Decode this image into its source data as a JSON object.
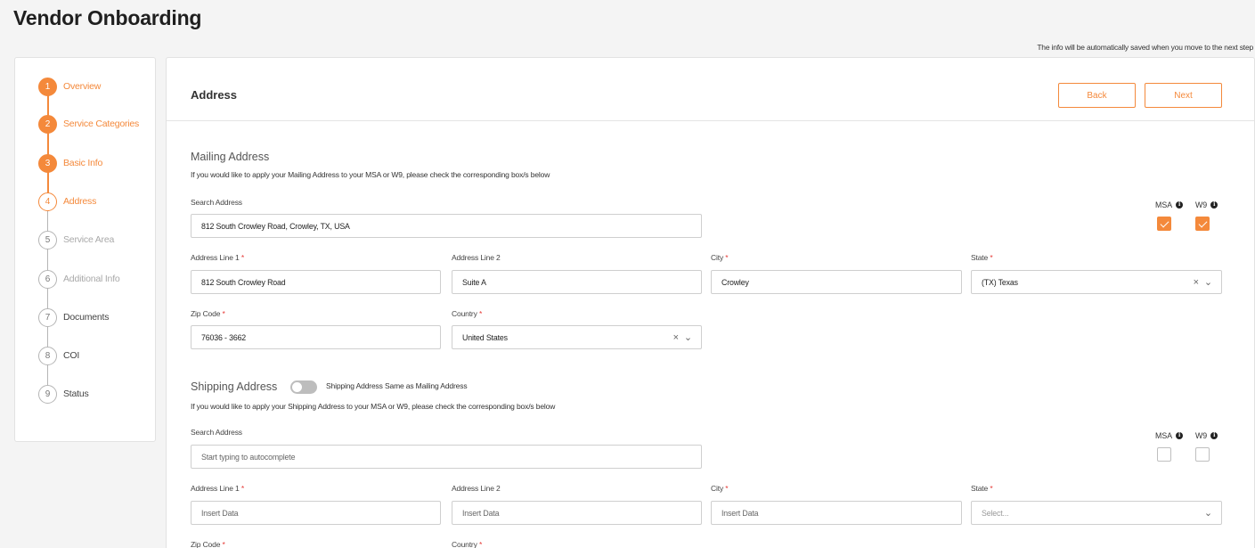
{
  "page": {
    "title": "Vendor Onboarding",
    "autosave_note": "The info will be automatically saved when you move to the next step"
  },
  "steps": [
    {
      "num": "1",
      "label": "Overview",
      "state": "done"
    },
    {
      "num": "2",
      "label": "Service Categories",
      "state": "done"
    },
    {
      "num": "3",
      "label": "Basic Info",
      "state": "done"
    },
    {
      "num": "4",
      "label": "Address",
      "state": "current"
    },
    {
      "num": "5",
      "label": "Service Area",
      "state": "pending"
    },
    {
      "num": "6",
      "label": "Additional Info",
      "state": "pending"
    },
    {
      "num": "7",
      "label": "Documents",
      "state": "pending"
    },
    {
      "num": "8",
      "label": "COI",
      "state": "pending"
    },
    {
      "num": "9",
      "label": "Status",
      "state": "pending"
    }
  ],
  "panel": {
    "title": "Address",
    "back_label": "Back",
    "next_label": "Next"
  },
  "mailing": {
    "title": "Mailing Address",
    "subtitle": "If you would like to apply your Mailing Address to your MSA or W9, please check the corresponding box/s below",
    "search_label": "Search Address",
    "search_value": "812 South Crowley Road, Crowley, TX, USA",
    "msa_label": "MSA",
    "w9_label": "W9",
    "msa_checked": true,
    "w9_checked": true,
    "line1_label": "Address Line 1",
    "line1_value": "812 South Crowley Road",
    "line2_label": "Address Line 2",
    "line2_value": "Suite A",
    "city_label": "City",
    "city_value": "Crowley",
    "state_label": "State",
    "state_value": "(TX) Texas",
    "zip_label": "Zip Code",
    "zip_value": "76036 - 3662",
    "country_label": "Country",
    "country_value": "United States"
  },
  "shipping": {
    "title": "Shipping Address",
    "toggle_label": "Shipping Address Same as Mailing Address",
    "toggle_on": false,
    "subtitle": "If you would like to apply your Shipping Address to your MSA or W9, please check the corresponding box/s below",
    "search_label": "Search Address",
    "search_placeholder": "Start typing to autocomplete",
    "msa_label": "MSA",
    "w9_label": "W9",
    "msa_checked": false,
    "w9_checked": false,
    "line1_label": "Address Line 1",
    "line1_placeholder": "Insert Data",
    "line2_label": "Address Line 2",
    "line2_placeholder": "Insert Data",
    "city_label": "City",
    "city_placeholder": "Insert Data",
    "state_label": "State",
    "state_placeholder": "Select...",
    "zip_label": "Zip Code",
    "country_label": "Country"
  },
  "icons": {
    "info": "info-icon",
    "clear": "close-icon",
    "dropdown": "chevron-down-icon",
    "check": "checkmark-icon"
  },
  "colors": {
    "accent": "#f4893b",
    "required": "#e53935",
    "background": "#f4f4f4"
  }
}
